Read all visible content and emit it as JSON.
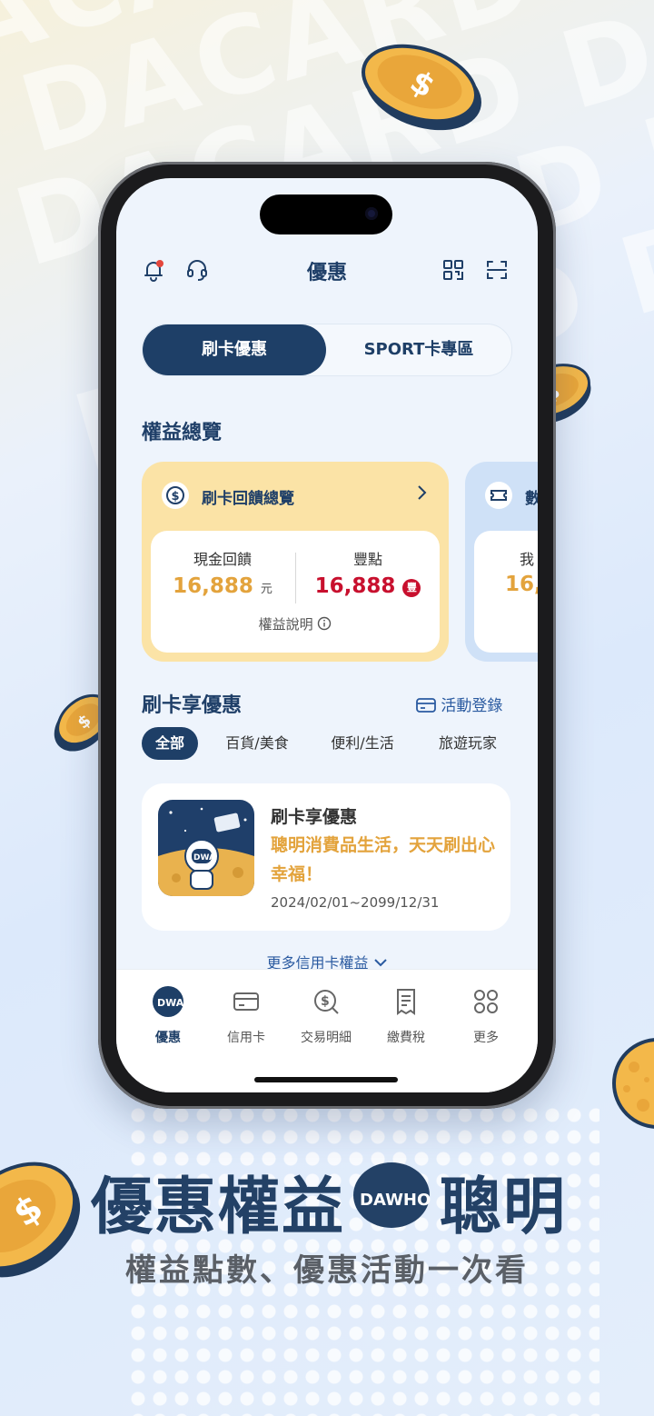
{
  "background": {
    "watermark_lines": [
      "ACARD DACARD DA",
      "DACARD DACARD",
      "DACARD DACARD D",
      "DACARD DACARD",
      "DACARD DA"
    ]
  },
  "header": {
    "title": "優惠"
  },
  "segment": {
    "active": "刷卡優惠",
    "inactive": "SPORT卡專區"
  },
  "overview": {
    "section_title": "權益總覽",
    "card1": {
      "title": "刷卡回饋總覽",
      "cash_label": "現金回饋",
      "cash_value": "16,888",
      "cash_unit": "元",
      "points_label": "豐點",
      "points_value": "16,888",
      "points_badge": "豐",
      "explain": "權益說明"
    },
    "card2": {
      "title_partial": "數",
      "label_partial": "我",
      "value_partial": "16,"
    }
  },
  "offers": {
    "section_title": "刷卡享優惠",
    "register_label": "活動登錄",
    "chips": [
      "全部",
      "百貨/美食",
      "便利/生活",
      "旅遊玩家"
    ],
    "promo": {
      "title": "刷卡享優惠",
      "description": "聰明消費品生活，天天刷出心幸福！",
      "date": "2024/02/01~2099/12/31"
    },
    "more_label": "更多信用卡權益"
  },
  "tabbar": {
    "items": [
      {
        "label": "優惠",
        "icon": "dawho-logo-icon"
      },
      {
        "label": "信用卡",
        "icon": "credit-card-icon"
      },
      {
        "label": "交易明細",
        "icon": "dollar-search-icon"
      },
      {
        "label": "繳費稅",
        "icon": "receipt-icon"
      },
      {
        "label": "更多",
        "icon": "grid-dots-icon"
      }
    ]
  },
  "marketing": {
    "headline_left": "優惠權益",
    "headline_logo": "DAWHO",
    "headline_right": "聰明",
    "subline": "權益點數、優惠活動一次看"
  },
  "colors": {
    "navy": "#1e3f67",
    "gold": "#e3a33c",
    "red": "#c8102e",
    "card_yellow": "#fbe3a6",
    "card_blue": "#cfe1f7"
  }
}
